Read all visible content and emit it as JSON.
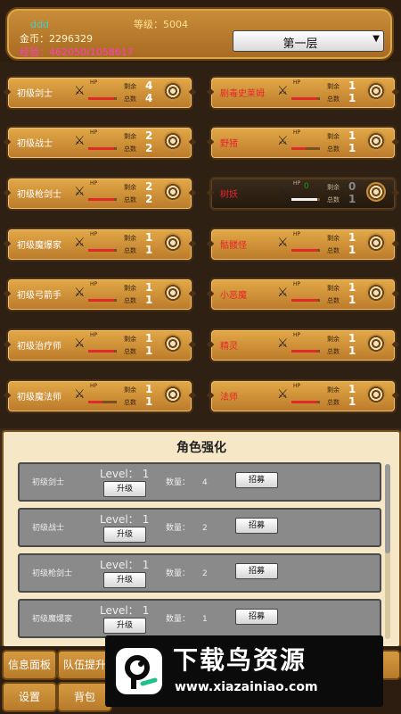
{
  "header": {
    "player_name": "ddd",
    "level_text": "等级：5004",
    "gold_text": "金币：2296329",
    "exp_text": "经验：462050/1058617",
    "floor_select": "第一层"
  },
  "left_units": [
    {
      "name": "初级剑士",
      "name_color": "#ffffff",
      "hp_label": "HP",
      "hp": "",
      "hp_fill": 0.9,
      "hp_fill_color": "red",
      "remain_label": "剩余",
      "remain": "4",
      "total_label": "总数",
      "total": "4"
    },
    {
      "name": "初级战士",
      "name_color": "#ffffff",
      "hp_label": "HP",
      "hp": "",
      "hp_fill": 0.9,
      "hp_fill_color": "red",
      "remain_label": "剩余",
      "remain": "2",
      "total_label": "总数",
      "total": "2"
    },
    {
      "name": "初级枪剑士",
      "name_color": "#ffffff",
      "hp_label": "HP",
      "hp": "",
      "hp_fill": 0.9,
      "hp_fill_color": "red",
      "remain_label": "剩余",
      "remain": "2",
      "total_label": "总数",
      "total": "2"
    },
    {
      "name": "初级魔爆家",
      "name_color": "#ffffff",
      "hp_label": "HP",
      "hp": "",
      "hp_fill": 0.9,
      "hp_fill_color": "red",
      "remain_label": "剩余",
      "remain": "1",
      "total_label": "总数",
      "total": "1"
    },
    {
      "name": "初级弓箭手",
      "name_color": "#ffffff",
      "hp_label": "HP",
      "hp": "",
      "hp_fill": 0.9,
      "hp_fill_color": "red",
      "remain_label": "剩余",
      "remain": "1",
      "total_label": "总数",
      "total": "1"
    },
    {
      "name": "初级治疗师",
      "name_color": "#ffffff",
      "hp_label": "HP",
      "hp": "",
      "hp_fill": 0.9,
      "hp_fill_color": "red",
      "remain_label": "剩余",
      "remain": "1",
      "total_label": "总数",
      "total": "1"
    },
    {
      "name": "初级魔法师",
      "name_color": "#ffffff",
      "hp_label": "HP",
      "hp": "",
      "hp_fill": 0.5,
      "hp_fill_color": "red",
      "remain_label": "剩余",
      "remain": "1",
      "total_label": "总数",
      "total": "1"
    }
  ],
  "right_units": [
    {
      "name": "剧毒史莱姆",
      "name_color": "#e8262a",
      "hp_label": "HP",
      "hp": "",
      "hp_fill": 0.9,
      "hp_fill_color": "red",
      "remain_label": "剩余",
      "remain": "1",
      "total_label": "总数",
      "total": "1",
      "dark": false
    },
    {
      "name": "野猪",
      "name_color": "#e8262a",
      "hp_label": "HP",
      "hp": "",
      "hp_fill": 0.5,
      "hp_fill_color": "red",
      "remain_label": "剩余",
      "remain": "1",
      "total_label": "总数",
      "total": "1",
      "dark": false
    },
    {
      "name": "树妖",
      "name_color": "#e8262a",
      "hp_label": "HP",
      "hp": "0",
      "hp_fill": 0.9,
      "hp_fill_color": "white",
      "remain_label": "剩余",
      "remain": "0",
      "total_label": "总数",
      "total": "1",
      "dark": true
    },
    {
      "name": "骷髅怪",
      "name_color": "#e8262a",
      "hp_label": "HP",
      "hp": "",
      "hp_fill": 0.9,
      "hp_fill_color": "red",
      "remain_label": "剩余",
      "remain": "1",
      "total_label": "总数",
      "total": "1",
      "dark": false
    },
    {
      "name": "小恶魔",
      "name_color": "#e8262a",
      "hp_label": "HP",
      "hp": "",
      "hp_fill": 0.9,
      "hp_fill_color": "red",
      "remain_label": "剩余",
      "remain": "1",
      "total_label": "总数",
      "total": "1",
      "dark": false
    },
    {
      "name": "精灵",
      "name_color": "#e8262a",
      "hp_label": "HP",
      "hp": "",
      "hp_fill": 0.9,
      "hp_fill_color": "red",
      "remain_label": "剩余",
      "remain": "1",
      "total_label": "总数",
      "total": "1",
      "dark": false
    },
    {
      "name": "法师",
      "name_color": "#e8262a",
      "hp_label": "HP",
      "hp": "",
      "hp_fill": 0.9,
      "hp_fill_color": "red",
      "remain_label": "剩余",
      "remain": "1",
      "total_label": "总数",
      "total": "1",
      "dark": false
    }
  ],
  "upgrade": {
    "title": "角色强化",
    "level_label": "Level：",
    "upgrade_label": "升级",
    "count_label": "数量：",
    "recruit_label": "招募",
    "rows": [
      {
        "name": "初级剑士",
        "level": "1",
        "count": "4"
      },
      {
        "name": "初级战士",
        "level": "1",
        "count": "2"
      },
      {
        "name": "初级枪剑士",
        "level": "1",
        "count": "2"
      },
      {
        "name": "初级魔爆家",
        "level": "1",
        "count": "1"
      }
    ]
  },
  "nav": {
    "info": "信息面板",
    "team": "队伍提升",
    "settings": "设置",
    "bag": "背包"
  },
  "watermark": {
    "title": "下载鸟资源",
    "url": "www.xiazainiao.com"
  },
  "colors": {
    "panel_gold": "#c98e3a",
    "hp_green": "#1a9a1a",
    "hp_red": "#e02a2a",
    "enemy_name": "#e8262a"
  }
}
